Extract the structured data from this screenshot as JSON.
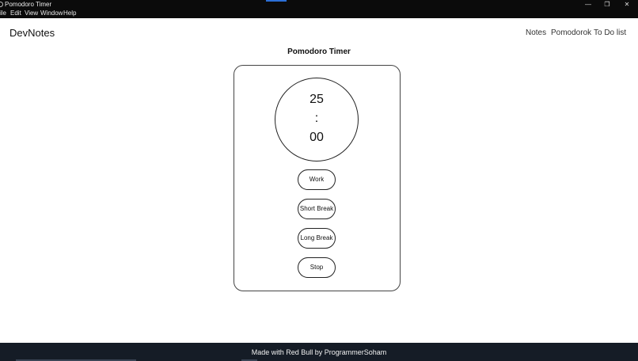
{
  "window": {
    "title": "Pomodoro Timer",
    "controls": {
      "minimize": "—",
      "restore": "❐",
      "close": "✕"
    }
  },
  "menu": {
    "items": [
      "ile",
      "Edit",
      "View",
      "Window",
      "Help"
    ]
  },
  "app": {
    "brand": "DevNotes",
    "nav": [
      "Notes",
      "Pomodorok",
      "To Do list"
    ]
  },
  "timer": {
    "page_title": "Pomodoro Timer",
    "minutes": "25",
    "separator": ":",
    "seconds": "00",
    "buttons": {
      "work": "Work",
      "short_break": "Short Break",
      "long_break": "Long Break",
      "stop": "Stop"
    }
  },
  "footer": {
    "text": "Made with Red Bull by ProgrammerSoham"
  },
  "colors": {
    "titlebar": "#0b0b0b",
    "footer": "#151c26",
    "accent": "#2b6fd6"
  }
}
